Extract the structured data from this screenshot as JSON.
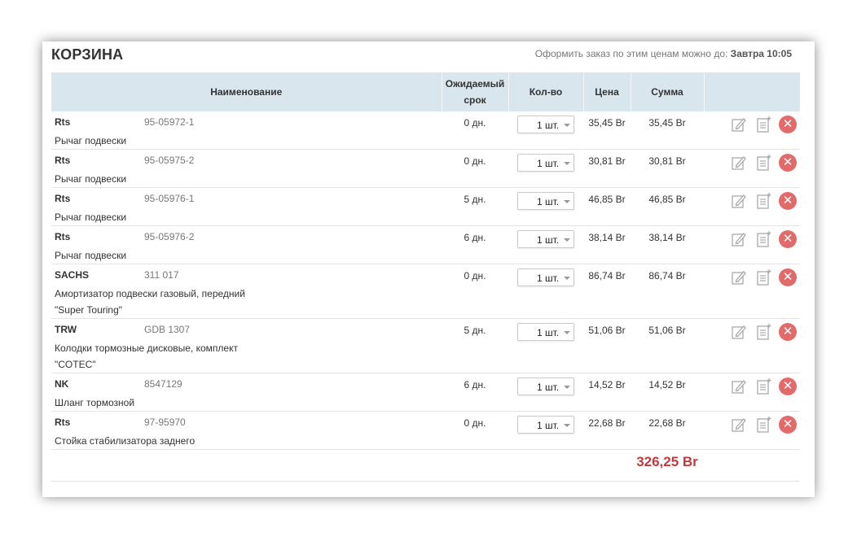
{
  "cart": {
    "title": "КОРЗИНА",
    "deadline_text": "Оформить заказ по этим ценам можно до:",
    "deadline_value": "Завтра 10:05"
  },
  "columns": {
    "name": "Наименование",
    "term_line1": "Ожидаемый",
    "term_line2": "срок",
    "qty": "Кол-во",
    "price": "Цена",
    "sum": "Сумма"
  },
  "rows": [
    {
      "brand": "Rts",
      "article": "95-05972-1",
      "desc": "Рычаг подвески",
      "term": "0 дн.",
      "qty": "1 шт.",
      "price": "35,45 Br",
      "sum": "35,45 Br"
    },
    {
      "brand": "Rts",
      "article": "95-05975-2",
      "desc": "Рычаг подвески",
      "term": "0 дн.",
      "qty": "1 шт.",
      "price": "30,81 Br",
      "sum": "30,81 Br"
    },
    {
      "brand": "Rts",
      "article": "95-05976-1",
      "desc": "Рычаг подвески",
      "term": "5 дн.",
      "qty": "1 шт.",
      "price": "46,85 Br",
      "sum": "46,85 Br"
    },
    {
      "brand": "Rts",
      "article": "95-05976-2",
      "desc": "Рычаг подвески",
      "term": "6 дн.",
      "qty": "1 шт.",
      "price": "38,14 Br",
      "sum": "38,14 Br"
    },
    {
      "brand": "SACHS",
      "article": "311 017",
      "desc": "Амортизатор подвески газовый, передний \"Super Touring\"",
      "term": "0 дн.",
      "qty": "1 шт.",
      "price": "86,74 Br",
      "sum": "86,74 Br"
    },
    {
      "brand": "TRW",
      "article": "GDB 1307",
      "desc": "Колодки тормозные дисковые, комплект \"COTEC\"",
      "term": "5 дн.",
      "qty": "1 шт.",
      "price": "51,06 Br",
      "sum": "51,06 Br"
    },
    {
      "brand": "NK",
      "article": "8547129",
      "desc": "Шланг тормозной",
      "term": "6 дн.",
      "qty": "1 шт.",
      "price": "14,52 Br",
      "sum": "14,52 Br"
    },
    {
      "brand": "Rts",
      "article": "97-95970",
      "desc": "Стойка стабилизатора заднего",
      "term": "0 дн.",
      "qty": "1 шт.",
      "price": "22,68 Br",
      "sum": "22,68 Br"
    }
  ],
  "icons": {
    "edit": "edit-icon",
    "note": "note-icon",
    "delete": "delete-icon",
    "delete_glyph": "✕"
  },
  "colors": {
    "header_bg": "#dae6ee",
    "total": "#c0393b",
    "delete": "#e36a6a"
  },
  "total": "326,25 Br"
}
